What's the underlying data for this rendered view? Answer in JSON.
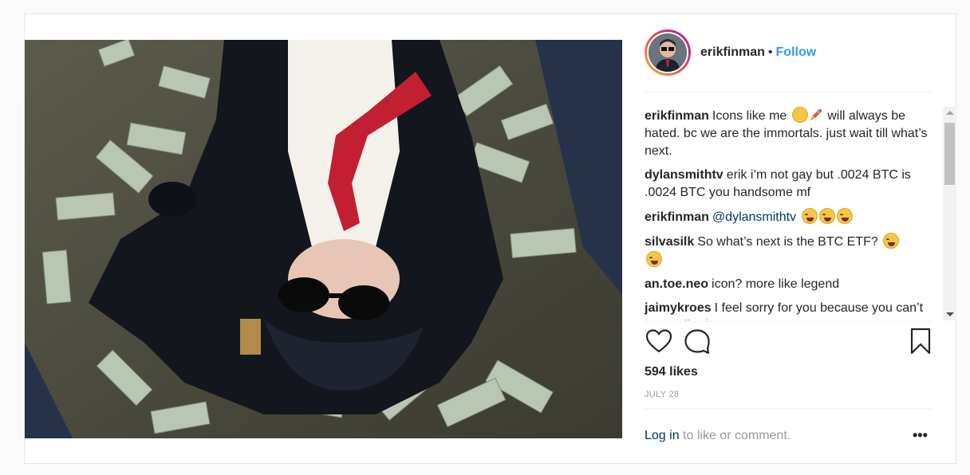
{
  "header": {
    "username": "erikfinman",
    "separator": "•",
    "follow_label": "Follow"
  },
  "comments": [
    {
      "user": "erikfinman",
      "parts": [
        "Icons like me",
        "will always be hated. bc we are the immortals. just wait till what’s next."
      ]
    },
    {
      "user": "dylansmithtv",
      "text": "erik i’m not gay but .0024 BTC is .0024 BTC you handsome mf"
    },
    {
      "user": "erikfinman",
      "mention": "@dylansmithtv"
    },
    {
      "user": "silvasilk",
      "text": "So what’s next is the BTC ETF?"
    },
    {
      "user": "an.toe.neo",
      "text": "icon? more like legend"
    },
    {
      "user": "jaimykroes",
      "text": "I feel sorry for you because you can’t even afford a matras"
    }
  ],
  "likes": "594 likes",
  "date": "JULY 28",
  "footer": {
    "login_label": "Log in",
    "rest": "to like or comment."
  },
  "more_label": "•••",
  "icons": {
    "like": "heart-icon",
    "comment": "comment-bubble-icon",
    "save": "bookmark-icon",
    "more": "more-options-icon"
  },
  "colors": {
    "follow": "#3897f0",
    "mention": "#003569",
    "muted": "#999999"
  }
}
